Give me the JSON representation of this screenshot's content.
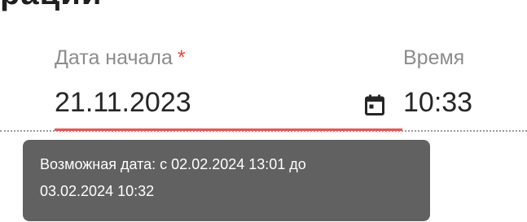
{
  "section": {
    "heading_fragment": "рации"
  },
  "form": {
    "date_label": "Дата начала",
    "required_mark": "*",
    "date_value": "21.11.2023",
    "time_label": "Время",
    "time_value": "10:33"
  },
  "tooltip": {
    "line1": "Возможная дата: с 02.02.2024 13:01 до",
    "line2": "03.02.2024 10:32"
  },
  "icons": {
    "calendar": "calendar-icon"
  },
  "colors": {
    "error_underline": "#ef5350",
    "required_mark": "#f44336",
    "tooltip_bg": "#616161",
    "label_text": "#8c8c8c",
    "value_text": "#262626"
  }
}
